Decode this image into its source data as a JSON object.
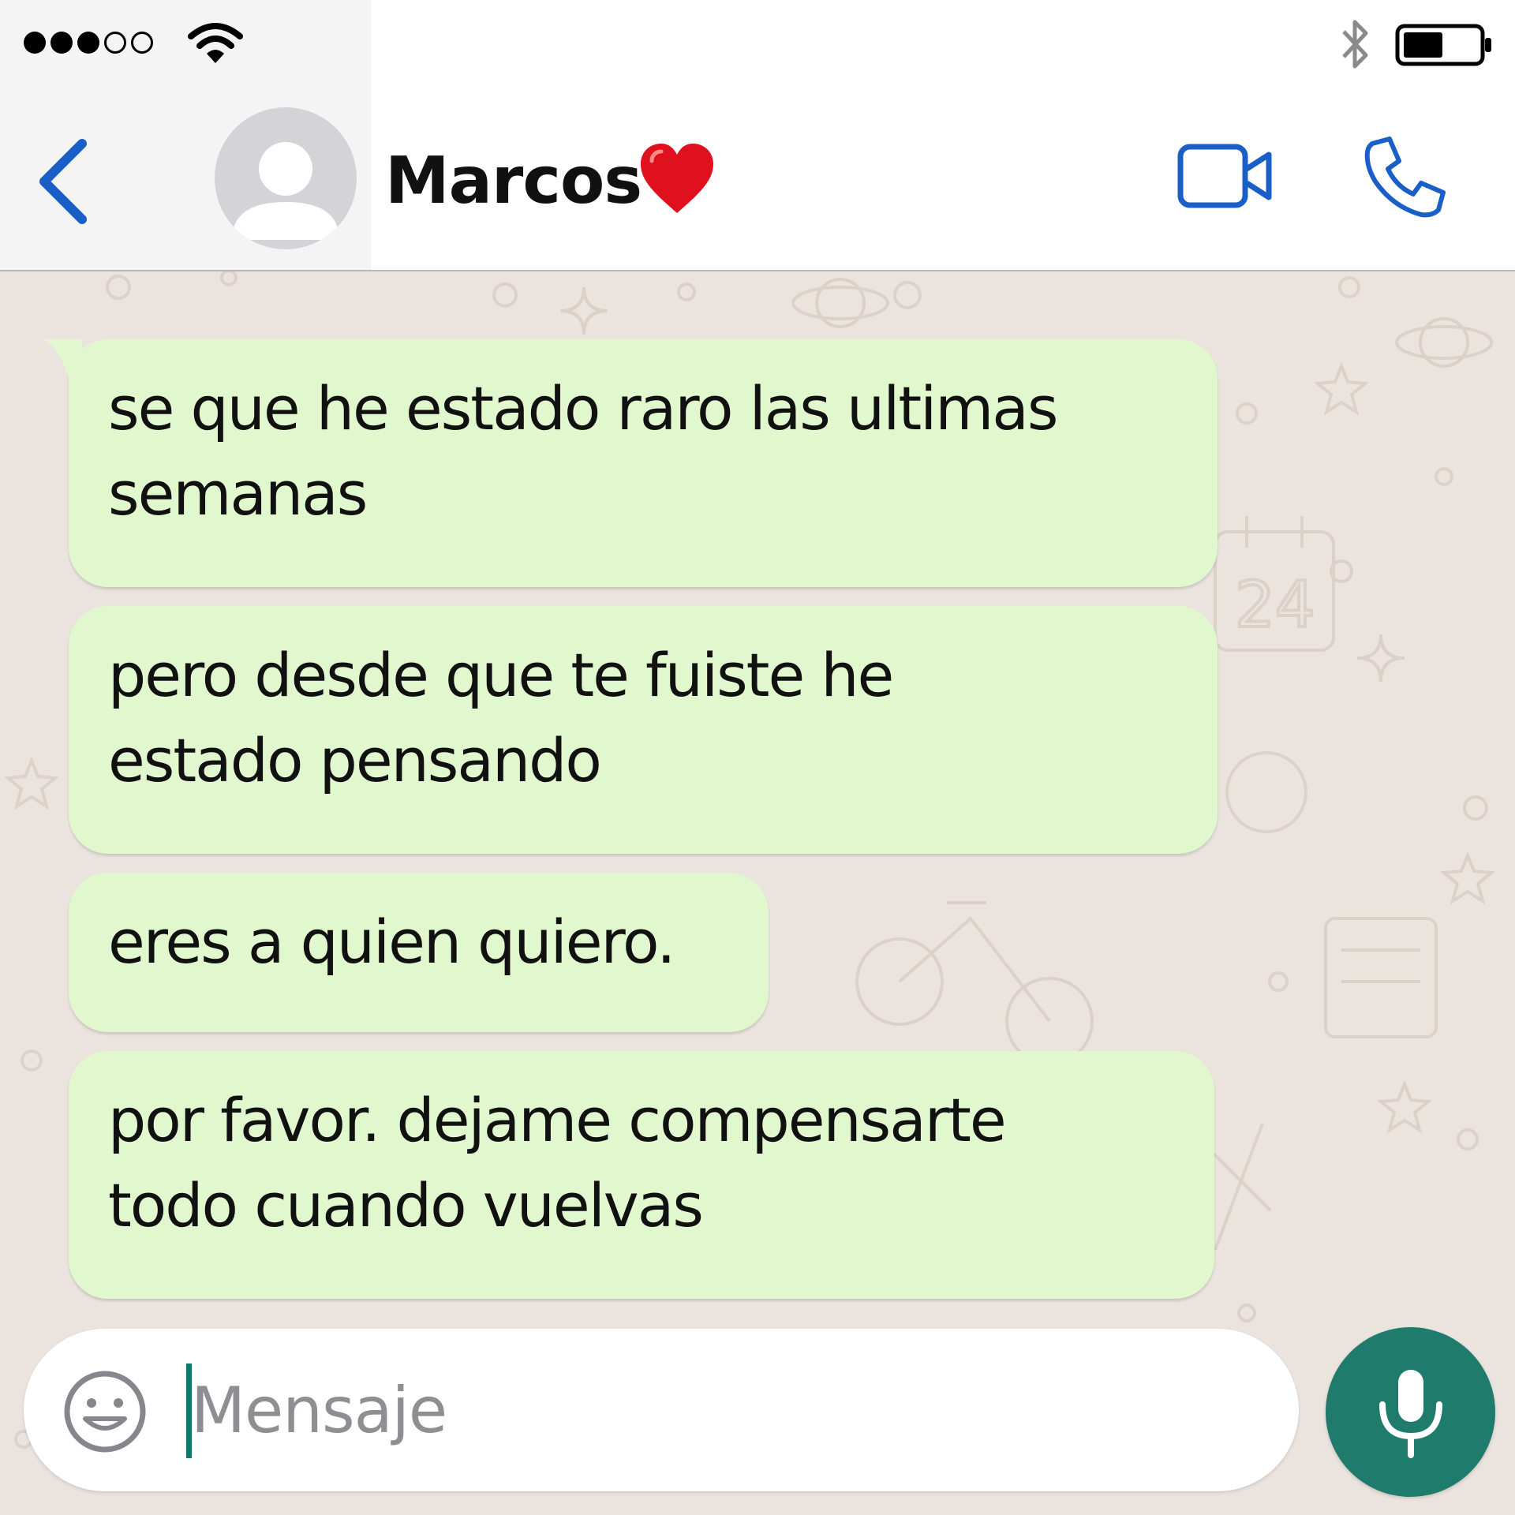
{
  "status_bar": {
    "signal_bars_filled": 3,
    "signal_bars_total": 5,
    "wifi_icon": "wifi-icon",
    "bluetooth_icon": "bluetooth-icon",
    "battery_level": 0.45
  },
  "header": {
    "back_icon": "chevron-left-icon",
    "avatar_icon": "default-avatar-icon",
    "contact_name": "Marcos",
    "contact_emoji": "red-heart-emoji",
    "video_call_icon": "video-camera-icon",
    "voice_call_icon": "phone-icon"
  },
  "messages": [
    {
      "text": "se que he estado raro las ultimas\nsemanas"
    },
    {
      "text": "pero desde que te fuiste he\nestado pensando"
    },
    {
      "text": "eres a quien quiero."
    },
    {
      "text": "por favor. dejame compensarte\ntodo cuando vuelvas"
    }
  ],
  "composer": {
    "emoji_icon": "smiley-icon",
    "placeholder": "Mensaje",
    "mic_icon": "microphone-icon"
  },
  "colors": {
    "accent_blue": "#1a5fc8",
    "bubble_incoming": "#e1f8cf",
    "chat_background": "#ebe4de",
    "mic_button": "#1f7c6d",
    "heart": "#e0101e"
  }
}
